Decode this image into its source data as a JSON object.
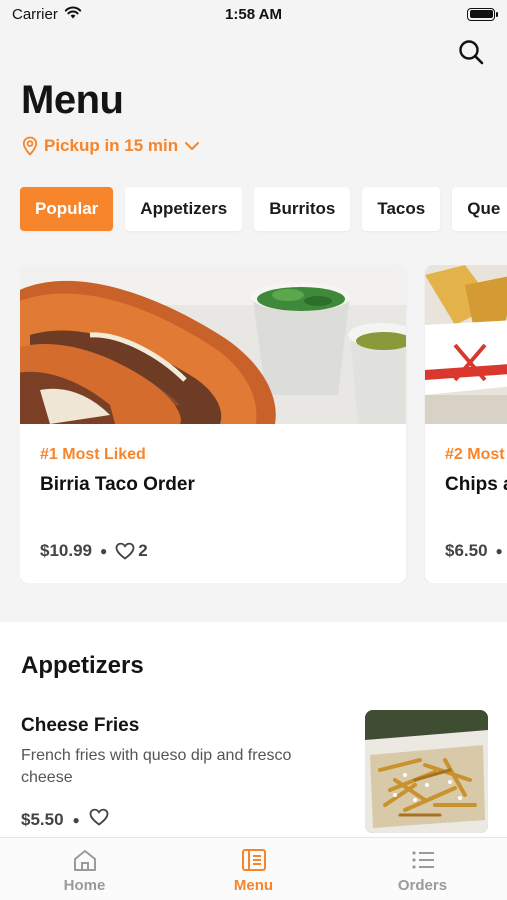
{
  "status_bar": {
    "carrier": "Carrier",
    "time": "1:58 AM"
  },
  "header": {
    "title": "Menu",
    "pickup_label": "Pickup in 15 min"
  },
  "categories": [
    {
      "label": "Popular",
      "active": true
    },
    {
      "label": "Appetizers",
      "active": false
    },
    {
      "label": "Burritos",
      "active": false
    },
    {
      "label": "Tacos",
      "active": false
    },
    {
      "label": "Que",
      "active": false
    }
  ],
  "featured": [
    {
      "rank": "#1 Most Liked",
      "name": "Birria Taco Order",
      "price": "$10.99",
      "likes": "2"
    },
    {
      "rank": "#2 Most",
      "name": "Chips a",
      "price": "$6.50"
    }
  ],
  "appetizers": {
    "title": "Appetizers",
    "item": {
      "name": "Cheese Fries",
      "description": "French fries with queso dip and fresco cheese",
      "price": "$5.50"
    }
  },
  "tab_bar": {
    "home": "Home",
    "menu": "Menu",
    "orders": "Orders",
    "active": "menu"
  },
  "colors": {
    "accent": "#f7852b",
    "background": "#f4f4f4",
    "card": "#ffffff"
  }
}
